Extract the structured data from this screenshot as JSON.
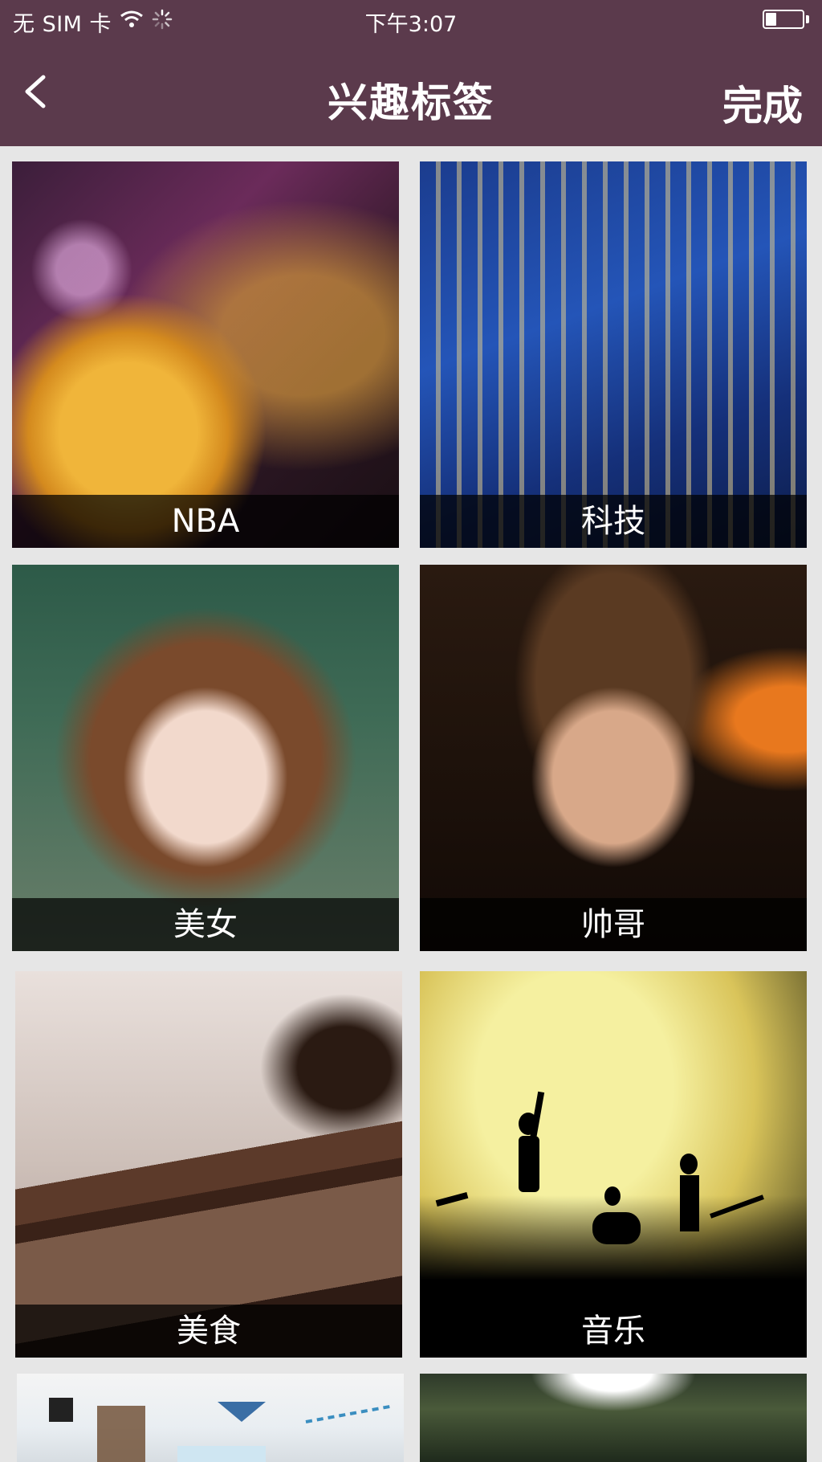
{
  "status_bar": {
    "carrier": "无 SIM 卡",
    "time": "下午3:07",
    "battery_level": 0.3
  },
  "nav": {
    "back_icon": "chevron-left-icon",
    "title": "兴趣标签",
    "done_label": "完成"
  },
  "tags": [
    {
      "label": "NBA"
    },
    {
      "label": "科技"
    },
    {
      "label": "美女"
    },
    {
      "label": "帅哥"
    },
    {
      "label": "美食"
    },
    {
      "label": "音乐"
    },
    {
      "label": ""
    },
    {
      "label": ""
    }
  ],
  "colors": {
    "header_bg": "#5b3a4c",
    "page_bg": "#e6e6e6",
    "label_overlay": "rgba(0,0,0,0.72)",
    "text": "#ffffff"
  }
}
